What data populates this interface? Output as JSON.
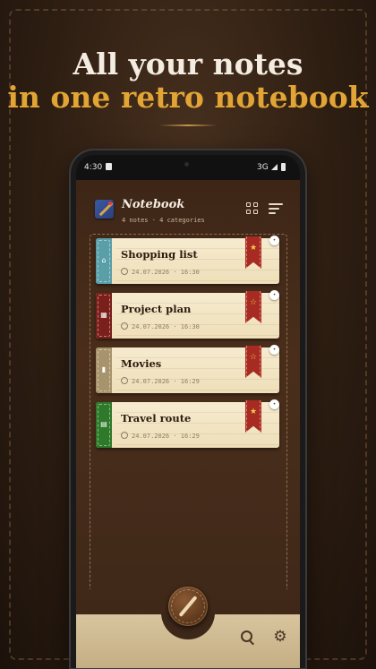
{
  "promo": {
    "headline_line1": "All your notes",
    "headline_line2": "in one retro notebook",
    "colors": {
      "line1": "#f4ece1",
      "line2": "#e2a535"
    }
  },
  "status_bar": {
    "time": "4:30",
    "network": "3G"
  },
  "app": {
    "title": "Notebook",
    "subtitle": "4 notes · 4 categories",
    "icons": [
      "grid-view-icon",
      "sort-icon"
    ]
  },
  "notes": [
    {
      "title": "Shopping list",
      "date": "24.07.2026 · 16:30",
      "tab_color": "#5a9fa8",
      "tab_icon": "basket-icon",
      "starred": true
    },
    {
      "title": "Project plan",
      "date": "24.07.2026 · 16:30",
      "tab_color": "#7a1f1a",
      "tab_icon": "calendar-icon",
      "starred": false
    },
    {
      "title": "Movies",
      "date": "24.07.2026 · 16:29",
      "tab_color": "#a8946c",
      "tab_icon": "film-icon",
      "starred": false
    },
    {
      "title": "Travel route",
      "date": "24.07.2026 · 16:29",
      "tab_color": "#2e7a2a",
      "tab_icon": "map-icon",
      "starred": true
    }
  ],
  "bottom_bar": {
    "icons": [
      "pen-icon",
      "search-icon",
      "settings-icon"
    ]
  },
  "glyphs": {
    "star_filled": "★",
    "star_outline": "☆",
    "pin": "📌",
    "basket": "🧺",
    "calendar": "▪",
    "film": "▮",
    "map": "▮",
    "gear": "⚙"
  }
}
